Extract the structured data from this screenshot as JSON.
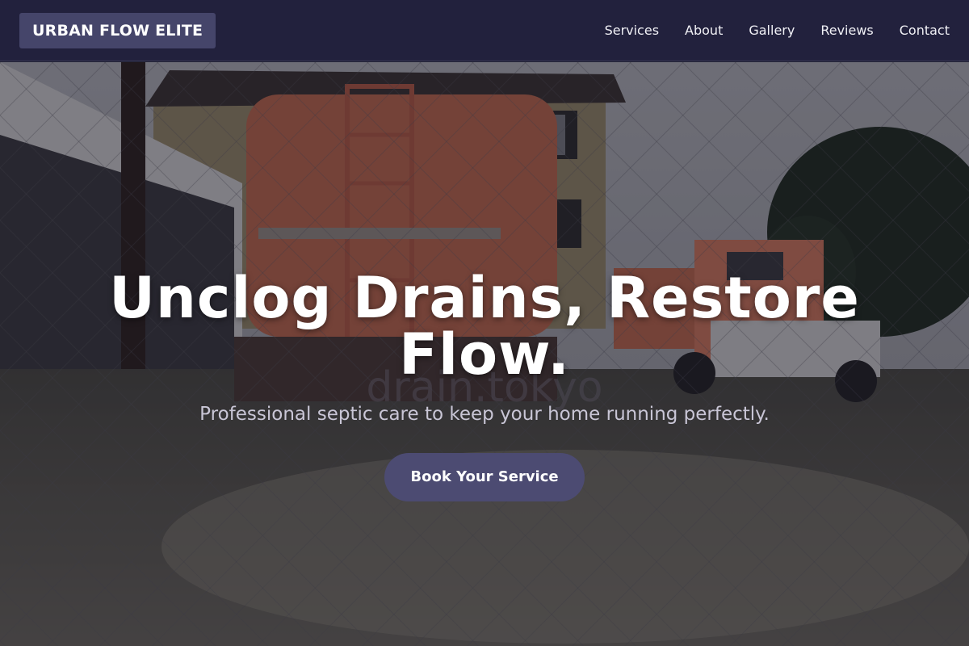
{
  "header": {
    "logo": "URBAN FLOW ELITE",
    "nav": [
      {
        "label": "Services"
      },
      {
        "label": "About"
      },
      {
        "label": "Gallery"
      },
      {
        "label": "Reviews"
      },
      {
        "label": "Contact"
      }
    ]
  },
  "hero": {
    "title": "Unclog Drains, Restore Flow.",
    "subtitle": "Professional septic care to keep your home running perfectly.",
    "cta_label": "Book Your Service",
    "image_watermark": "drain.tokyo"
  },
  "colors": {
    "nav_bg": "#22213d",
    "logo_bg": "#45456a",
    "cta_bg": "#4c4b72",
    "text_light": "#ffffff",
    "subtitle": "#c9c6d6",
    "truck": "#c46a4e"
  }
}
